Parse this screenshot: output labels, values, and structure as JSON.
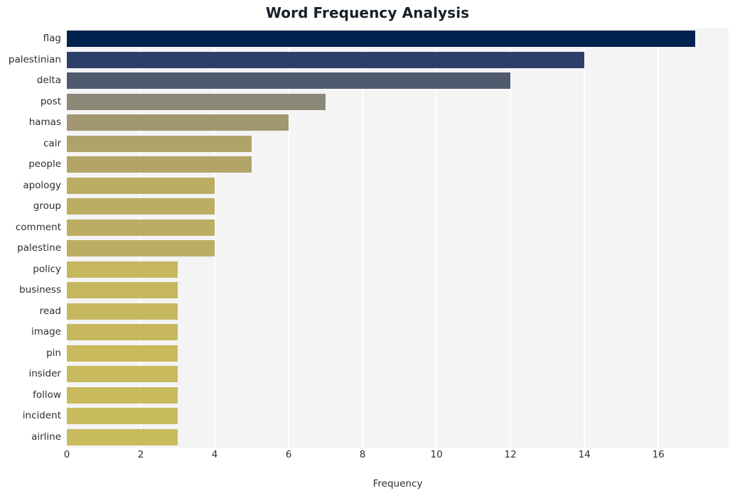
{
  "chart_data": {
    "type": "bar",
    "orientation": "horizontal",
    "title": "Word Frequency Analysis",
    "xlabel": "Frequency",
    "ylabel": "",
    "categories": [
      "flag",
      "palestinian",
      "delta",
      "post",
      "hamas",
      "cair",
      "people",
      "apology",
      "group",
      "comment",
      "palestine",
      "policy",
      "business",
      "read",
      "image",
      "pin",
      "insider",
      "follow",
      "incident",
      "airline"
    ],
    "values": [
      17,
      14,
      12,
      7,
      6,
      5,
      5,
      4,
      4,
      4,
      4,
      3,
      3,
      3,
      3,
      3,
      3,
      3,
      3,
      3
    ],
    "xlim": [
      0,
      17.9
    ],
    "xticks": [
      0,
      2,
      4,
      6,
      8,
      10,
      12,
      14,
      16
    ],
    "xtick_labels": [
      "0",
      "2",
      "4",
      "6",
      "8",
      "10",
      "12",
      "14",
      "16"
    ],
    "grid": true,
    "grid_axis": "x",
    "legend": null,
    "colormap": "cividis",
    "bar_colors": [
      "#00224e",
      "#2d3f69",
      "#4f5a6e",
      "#8d8979",
      "#a29770",
      "#b0a368",
      "#b2a567",
      "#bcad63",
      "#bcad63",
      "#bcad63",
      "#bcad63",
      "#c6b75f",
      "#c6b75f",
      "#c6b75f",
      "#c6b75f",
      "#c9ba5e",
      "#c9ba5e",
      "#c9ba5e",
      "#c9bc5e",
      "#c9bc5e"
    ],
    "plot_background": "#f4f4f5",
    "gridline_color": "#ffffff",
    "figure_background": "#ffffff",
    "title_color": "#17202a"
  }
}
